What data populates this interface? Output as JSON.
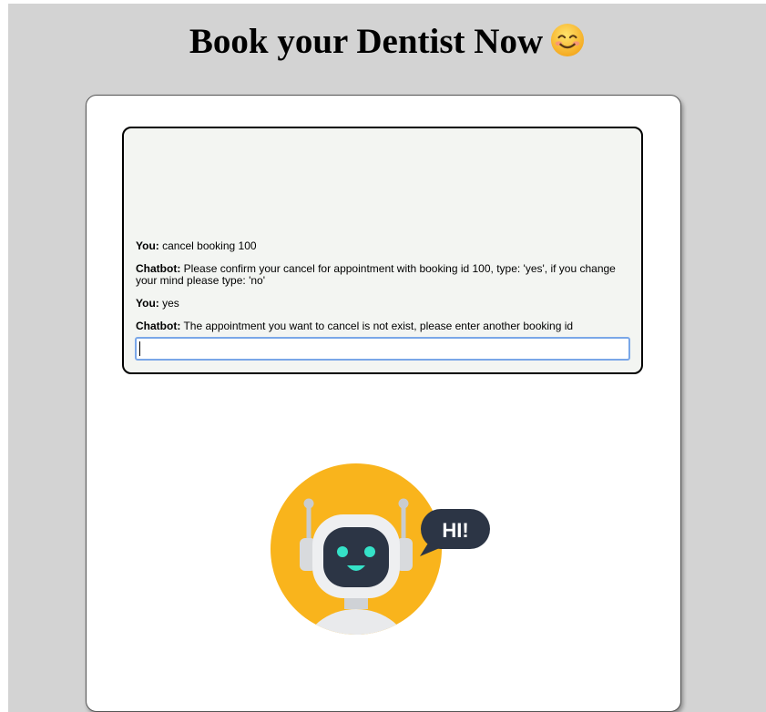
{
  "header": {
    "title": "Book your Dentist Now"
  },
  "chat": {
    "messages": [
      {
        "speaker": "You:",
        "text": "cancel booking 100"
      },
      {
        "speaker": "Chatbot:",
        "text": "Please confirm your cancel for appointment with booking id 100, type: 'yes', if you change your mind please type: 'no'"
      },
      {
        "speaker": "You:",
        "text": "yes"
      },
      {
        "speaker": "Chatbot:",
        "text": "The appointment you want to cancel is not exist, please enter another booking id"
      }
    ],
    "input": {
      "value": "",
      "placeholder": ""
    }
  },
  "illustration": {
    "speech_bubble": "HI!"
  },
  "colors": {
    "page_background": "#d3d3d3",
    "card_background": "#ffffff",
    "chat_background": "#f3f5f2",
    "input_focus_border": "#7aa7e8",
    "robot_circle": "#f9b41c",
    "robot_face_screen": "#2c3545",
    "robot_eyes": "#35e2c8"
  },
  "icons": {
    "title_emoji": "smiling-face-icon",
    "illustration": "robot-icon"
  }
}
